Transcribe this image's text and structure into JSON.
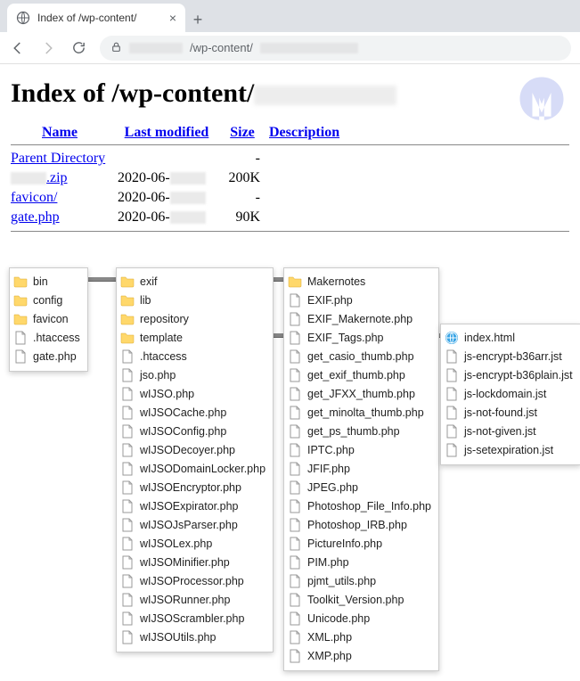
{
  "browser": {
    "tab_title": "Index of /wp-content/",
    "url_path": "/wp-content/",
    "new_tab": "+"
  },
  "page": {
    "heading_prefix": "Index of /wp-content/"
  },
  "dir_header": {
    "name": "Name",
    "last_modified": "Last modified",
    "size": "Size",
    "description": "Description"
  },
  "dir_rows": [
    {
      "name": "Parent Directory",
      "mod": "",
      "size": "-",
      "redact_prefix": false
    },
    {
      "name": ".zip",
      "mod": "2020-06-",
      "size": "200K",
      "redact_prefix": true
    },
    {
      "name": "favicon/",
      "mod": "2020-06-",
      "size": "-",
      "redact_prefix": false
    },
    {
      "name": "gate.php",
      "mod": "2020-06-",
      "size": "90K",
      "redact_prefix": false
    }
  ],
  "panels": {
    "p1": [
      {
        "type": "folder",
        "name": "bin"
      },
      {
        "type": "folder",
        "name": "config"
      },
      {
        "type": "folder",
        "name": "favicon"
      },
      {
        "type": "file",
        "name": ".htaccess"
      },
      {
        "type": "file",
        "name": "gate.php"
      }
    ],
    "p2": [
      {
        "type": "folder",
        "name": "exif"
      },
      {
        "type": "folder",
        "name": "lib"
      },
      {
        "type": "folder",
        "name": "repository"
      },
      {
        "type": "folder",
        "name": "template"
      },
      {
        "type": "file",
        "name": ".htaccess"
      },
      {
        "type": "file",
        "name": "jso.php"
      },
      {
        "type": "file",
        "name": "wIJSO.php"
      },
      {
        "type": "file",
        "name": "wIJSOCache.php"
      },
      {
        "type": "file",
        "name": "wIJSOConfig.php"
      },
      {
        "type": "file",
        "name": "wIJSODecoyer.php"
      },
      {
        "type": "file",
        "name": "wIJSODomainLocker.php"
      },
      {
        "type": "file",
        "name": "wIJSOEncryptor.php"
      },
      {
        "type": "file",
        "name": "wIJSOExpirator.php"
      },
      {
        "type": "file",
        "name": "wIJSOJsParser.php"
      },
      {
        "type": "file",
        "name": "wIJSOLex.php"
      },
      {
        "type": "file",
        "name": "wIJSOMinifier.php"
      },
      {
        "type": "file",
        "name": "wIJSOProcessor.php"
      },
      {
        "type": "file",
        "name": "wIJSORunner.php"
      },
      {
        "type": "file",
        "name": "wIJSOScrambler.php"
      },
      {
        "type": "file",
        "name": "wIJSOUtils.php"
      }
    ],
    "p3": [
      {
        "type": "folder",
        "name": "Makernotes"
      },
      {
        "type": "file",
        "name": "EXIF.php"
      },
      {
        "type": "file",
        "name": "EXIF_Makernote.php"
      },
      {
        "type": "file",
        "name": "EXIF_Tags.php"
      },
      {
        "type": "file",
        "name": "get_casio_thumb.php"
      },
      {
        "type": "file",
        "name": "get_exif_thumb.php"
      },
      {
        "type": "file",
        "name": "get_JFXX_thumb.php"
      },
      {
        "type": "file",
        "name": "get_minolta_thumb.php"
      },
      {
        "type": "file",
        "name": "get_ps_thumb.php"
      },
      {
        "type": "file",
        "name": "IPTC.php"
      },
      {
        "type": "file",
        "name": "JFIF.php"
      },
      {
        "type": "file",
        "name": "JPEG.php"
      },
      {
        "type": "file",
        "name": "Photoshop_File_Info.php"
      },
      {
        "type": "file",
        "name": "Photoshop_IRB.php"
      },
      {
        "type": "file",
        "name": "PictureInfo.php"
      },
      {
        "type": "file",
        "name": "PIM.php"
      },
      {
        "type": "file",
        "name": "pjmt_utils.php"
      },
      {
        "type": "file",
        "name": "Toolkit_Version.php"
      },
      {
        "type": "file",
        "name": "Unicode.php"
      },
      {
        "type": "file",
        "name": "XML.php"
      },
      {
        "type": "file",
        "name": "XMP.php"
      }
    ],
    "p4": [
      {
        "type": "html",
        "name": "index.html"
      },
      {
        "type": "file",
        "name": "js-encrypt-b36arr.jst"
      },
      {
        "type": "file",
        "name": "js-encrypt-b36plain.jst"
      },
      {
        "type": "file",
        "name": "js-lockdomain.jst"
      },
      {
        "type": "file",
        "name": "js-not-found.jst"
      },
      {
        "type": "file",
        "name": "js-not-given.jst"
      },
      {
        "type": "file",
        "name": "js-setexpiration.jst"
      }
    ]
  }
}
